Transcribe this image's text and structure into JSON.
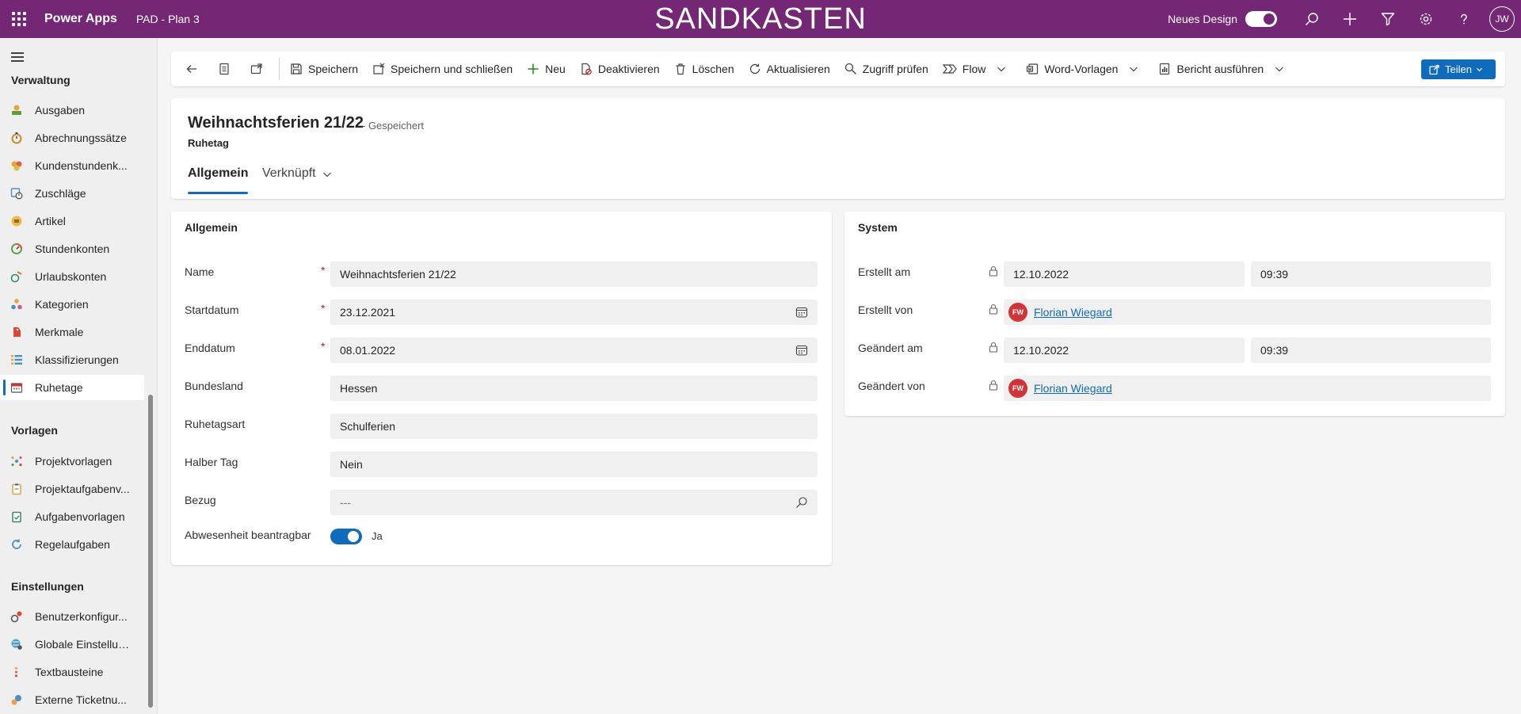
{
  "topbar": {
    "app_name": "Power Apps",
    "environment": "PAD - Plan 3",
    "sandbox_label": "SANDKASTEN",
    "new_design_label": "Neues Design",
    "user_initials": "JW",
    "color": "#742774"
  },
  "sidebar": {
    "groups": [
      {
        "title": "Verwaltung",
        "items": [
          {
            "label": "Ausgaben",
            "icon": "money-icon"
          },
          {
            "label": "Abrechnungssätze",
            "icon": "stopwatch-icon"
          },
          {
            "label": "Kundenstundenk...",
            "icon": "customer-hours-icon"
          },
          {
            "label": "Zuschläge",
            "icon": "surcharge-icon"
          },
          {
            "label": "Artikel",
            "icon": "article-icon"
          },
          {
            "label": "Stundenkonten",
            "icon": "gauge-icon"
          },
          {
            "label": "Urlaubskonten",
            "icon": "vacation-icon"
          },
          {
            "label": "Kategorien",
            "icon": "categories-icon"
          },
          {
            "label": "Merkmale",
            "icon": "tag-icon"
          },
          {
            "label": "Klassifizierungen",
            "icon": "list-icon"
          },
          {
            "label": "Ruhetage",
            "icon": "calendar-icon",
            "active": true
          }
        ]
      },
      {
        "title": "Vorlagen",
        "items": [
          {
            "label": "Projektvorlagen",
            "icon": "project-template-icon"
          },
          {
            "label": "Projektaufgabenv...",
            "icon": "clipboard-icon"
          },
          {
            "label": "Aufgabenvorlagen",
            "icon": "task-template-icon"
          },
          {
            "label": "Regelaufgaben",
            "icon": "recurring-icon"
          }
        ]
      },
      {
        "title": "Einstellungen",
        "items": [
          {
            "label": "Benutzerkonfigur...",
            "icon": "user-config-icon"
          },
          {
            "label": "Globale Einstellun...",
            "icon": "global-settings-icon"
          },
          {
            "label": "Textbausteine",
            "icon": "text-blocks-icon"
          },
          {
            "label": "Externe Ticketnu...",
            "icon": "ticket-icon"
          }
        ]
      }
    ]
  },
  "commands": {
    "save": "Speichern",
    "save_close": "Speichern und schließen",
    "new": "Neu",
    "deactivate": "Deaktivieren",
    "delete": "Löschen",
    "refresh": "Aktualisieren",
    "check_access": "Zugriff prüfen",
    "flow": "Flow",
    "word_templates": "Word-Vorlagen",
    "run_report": "Bericht ausführen",
    "share": "Teilen"
  },
  "header": {
    "title": "Weihnachtsferien 21/22",
    "status": "- Gespeichert",
    "entity": "Ruhetag",
    "tabs": [
      "Allgemein",
      "Verknüpft"
    ]
  },
  "general": {
    "title": "Allgemein",
    "name_label": "Name",
    "name_value": "Weihnachtsferien 21/22",
    "start_label": "Startdatum",
    "start_value": "23.12.2021",
    "end_label": "Enddatum",
    "end_value": "08.01.2022",
    "state_label": "Bundesland",
    "state_value": "Hessen",
    "type_label": "Ruhetagsart",
    "type_value": "Schulferien",
    "halfday_label": "Halber Tag",
    "halfday_value": "Nein",
    "ref_label": "Bezug",
    "ref_value": "---",
    "absence_label": "Abwesenheit beantragbar",
    "absence_value": "Ja",
    "required_mark": "*"
  },
  "system": {
    "title": "System",
    "created_on_label": "Erstellt am",
    "created_on_date": "12.10.2022",
    "created_on_time": "09:39",
    "created_by_label": "Erstellt von",
    "created_by_initials": "FW",
    "created_by_name": "Florian Wiegard",
    "modified_on_label": "Geändert am",
    "modified_on_date": "12.10.2022",
    "modified_on_time": "09:39",
    "modified_by_label": "Geändert von",
    "modified_by_initials": "FW",
    "modified_by_name": "Florian Wiegard"
  }
}
